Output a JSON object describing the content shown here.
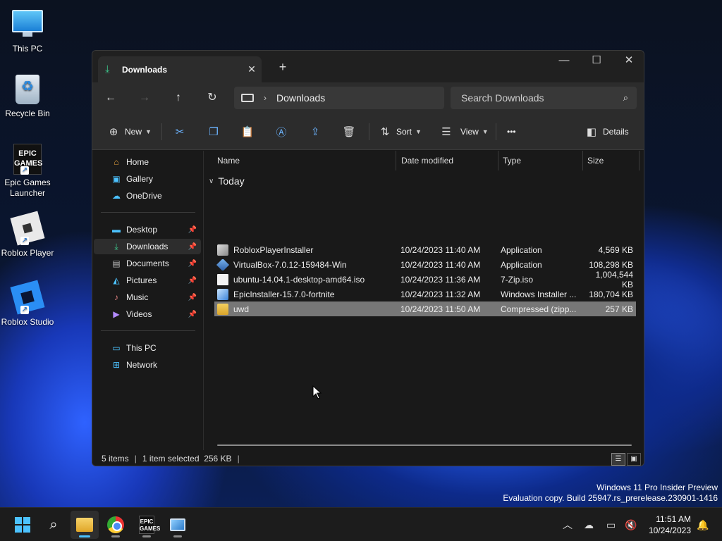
{
  "desktop": {
    "icons": [
      {
        "label": "This PC"
      },
      {
        "label": "Recycle Bin"
      },
      {
        "label": "Epic Games Launcher",
        "line1": "Epic Games",
        "line2": "Launcher"
      },
      {
        "label": "Roblox Player"
      },
      {
        "label": "Roblox Studio"
      }
    ]
  },
  "window": {
    "tab_title": "Downloads",
    "new_tab_label": "+",
    "address": {
      "crumb": "Downloads"
    },
    "search": {
      "placeholder": "Search Downloads"
    },
    "toolbar": {
      "new_label": "New",
      "sort_label": "Sort",
      "view_label": "View",
      "more_label": "•••",
      "details_label": "Details"
    },
    "sidebar": {
      "top": [
        {
          "label": "Home"
        },
        {
          "label": "Gallery"
        },
        {
          "label": "OneDrive"
        }
      ],
      "quick": [
        {
          "label": "Desktop"
        },
        {
          "label": "Downloads"
        },
        {
          "label": "Documents"
        },
        {
          "label": "Pictures"
        },
        {
          "label": "Music"
        },
        {
          "label": "Videos"
        }
      ],
      "bottom": [
        {
          "label": "This PC"
        },
        {
          "label": "Network"
        }
      ]
    },
    "columns": {
      "name": "Name",
      "date": "Date modified",
      "type": "Type",
      "size": "Size"
    },
    "group_label": "Today",
    "files": [
      {
        "name": "RobloxPlayerInstaller",
        "date": "10/24/2023 11:40 AM",
        "type": "Application",
        "size": "4,569 KB"
      },
      {
        "name": "VirtualBox-7.0.12-159484-Win",
        "date": "10/24/2023 11:40 AM",
        "type": "Application",
        "size": "108,298 KB"
      },
      {
        "name": "ubuntu-14.04.1-desktop-amd64.iso",
        "date": "10/24/2023 11:36 AM",
        "type": "7-Zip.iso",
        "size": "1,004,544 KB"
      },
      {
        "name": "EpicInstaller-15.7.0-fortnite",
        "date": "10/24/2023 11:32 AM",
        "type": "Windows Installer ...",
        "size": "180,704 KB"
      },
      {
        "name": "uwd",
        "date": "10/24/2023 11:50 AM",
        "type": "Compressed (zipp...",
        "size": "257 KB"
      }
    ],
    "status": {
      "items": "5 items",
      "selected": "1 item selected  256 KB"
    }
  },
  "watermark": {
    "line1": "Windows 11 Pro Insider Preview",
    "line2": "Evaluation copy. Build 25947.rs_prerelease.230901-1416"
  },
  "taskbar": {
    "time": "11:51 AM",
    "date": "10/24/2023"
  },
  "colors": {
    "accent": "#4cc2ff",
    "selection": "#777777",
    "window_bg": "#191919",
    "chrome_bg": "#2c2c2c"
  }
}
